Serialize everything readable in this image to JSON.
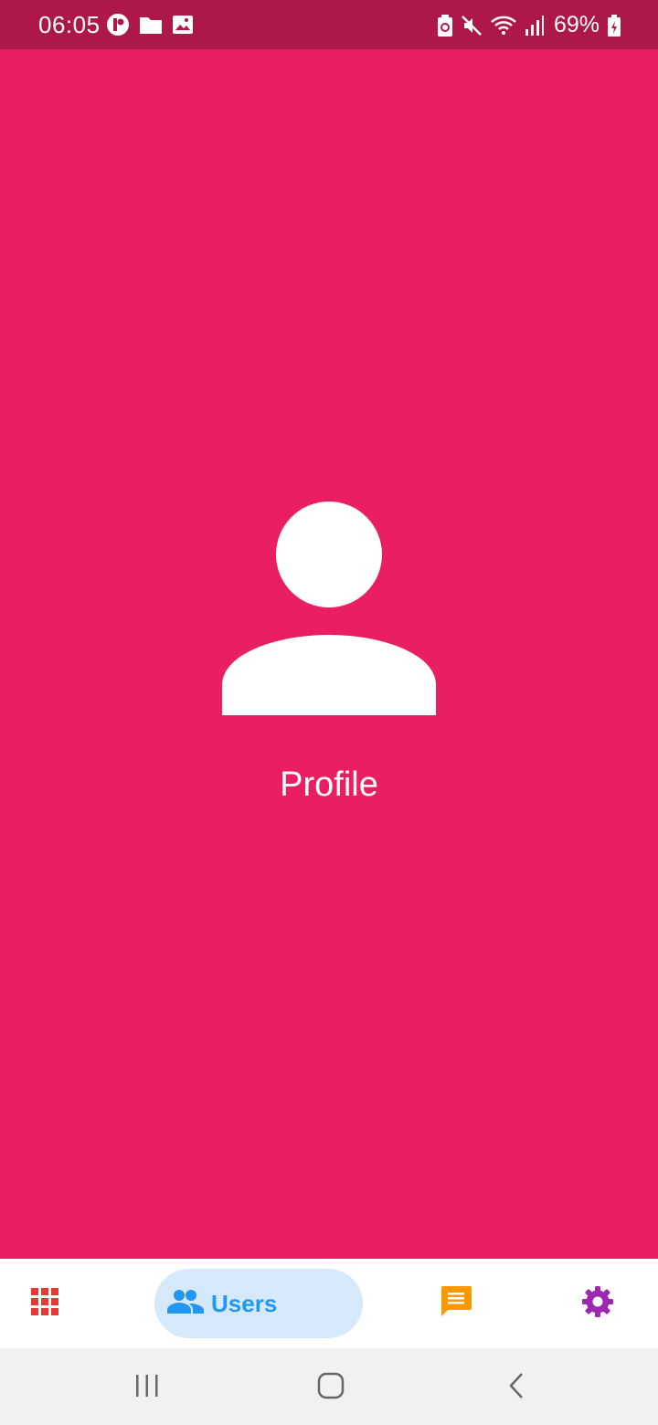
{
  "status_bar": {
    "time": "06:05",
    "battery_percent": "69%",
    "left_icons": [
      "notification-app-icon",
      "folder-icon",
      "image-icon"
    ],
    "right_icons": [
      "battery-saver-icon",
      "mute-icon",
      "wifi-icon",
      "signal-icon",
      "battery-charging-icon"
    ]
  },
  "main": {
    "illustration_icon": "person-icon",
    "label": "Profile"
  },
  "bottom_nav": {
    "items": [
      {
        "icon": "apps-grid-icon",
        "label": "",
        "color": "#E53935",
        "active": false
      },
      {
        "icon": "people-icon",
        "label": "Users",
        "color": "#2196F3",
        "active": true
      },
      {
        "icon": "chat-icon",
        "label": "",
        "color": "#FF9800",
        "active": false
      },
      {
        "icon": "gear-icon",
        "label": "",
        "color": "#9C27B0",
        "active": false
      }
    ]
  },
  "system_nav": {
    "buttons": [
      "recents-icon",
      "home-icon",
      "back-icon"
    ]
  },
  "colors": {
    "background": "#E91E63",
    "status_bar": "#AD1848",
    "active_pill": "#D6E9FB",
    "system_nav": "#F1F1F1"
  }
}
